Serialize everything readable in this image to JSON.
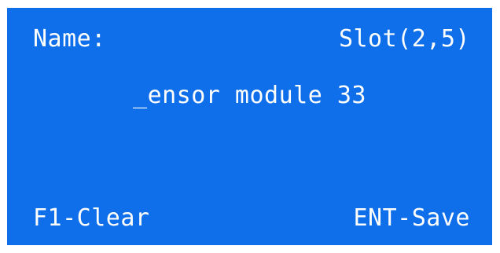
{
  "screen": {
    "background_color": "#0f6ee9",
    "text_color": "#ffffff",
    "header": {
      "field_label": "Name:",
      "slot": "Slot(2,5)"
    },
    "edit": {
      "cursor_char": "_",
      "value_rest": "ensor module 33"
    },
    "footer": {
      "f1_action": "F1-Clear",
      "ent_action": "ENT-Save"
    }
  }
}
